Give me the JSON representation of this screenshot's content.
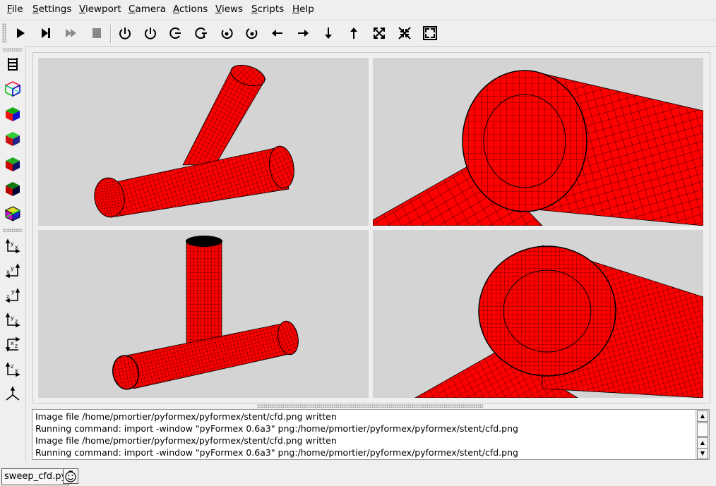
{
  "menubar": {
    "items": [
      {
        "accel": "F",
        "rest": "ile"
      },
      {
        "accel": "S",
        "rest": "ettings"
      },
      {
        "accel": "V",
        "rest": "iewport"
      },
      {
        "accel": "C",
        "rest": "amera"
      },
      {
        "accel": "A",
        "rest": "ctions"
      },
      {
        "accel": "V",
        "rest": "iews"
      },
      {
        "accel": "S",
        "rest": "cripts"
      },
      {
        "accel": "H",
        "rest": "elp"
      }
    ]
  },
  "toolbar": {
    "icons": [
      "play-icon",
      "step-icon",
      "continue-icon",
      "stop-icon",
      "rotate-left-icon",
      "rotate-right-icon",
      "rotate-up-icon",
      "rotate-down-icon",
      "rotate-cw-icon",
      "rotate-ccw-icon",
      "pan-left-icon",
      "pan-right-icon",
      "pan-down-icon",
      "pan-up-icon",
      "zoom-in-icon",
      "zoom-out-icon",
      "zoom-all-icon"
    ]
  },
  "side_toolbar": {
    "render_icons": [
      "wireframe-icon",
      "smooth-icon",
      "smoothwire-icon",
      "flat-icon",
      "flatwire-icon",
      "smooth-transparent-icon",
      "transparent-icon"
    ],
    "view_icons": [
      {
        "name": "front-view-icon",
        "a": "y",
        "b": "x"
      },
      {
        "name": "back-view-icon",
        "a": "y",
        "b": "x"
      },
      {
        "name": "right-view-icon",
        "a": "y",
        "b": "z"
      },
      {
        "name": "left-view-icon",
        "a": "y",
        "b": "z"
      },
      {
        "name": "top-view-icon",
        "a": "x",
        "b": "z"
      },
      {
        "name": "bottom-view-icon",
        "a": "z",
        "b": "x"
      },
      {
        "name": "iso-view-icon",
        "a": "",
        "b": ""
      }
    ]
  },
  "colors": {
    "mesh_fill": "#ff0000",
    "mesh_line": "#000000",
    "viewport_bg": "#d4d4d4"
  },
  "console": {
    "lines": [
      "Image file /home/pmortier/pyformex/pyformex/stent/cfd.png written",
      "Running command: import -window \"pyFormex 0.6a3\" png:/home/pmortier/pyformex/pyformex/stent/cfd.png",
      "Image file /home/pmortier/pyformex/pyformex/stent/cfd.png written",
      "Running command: import -window \"pyFormex 0.6a3\" png:/home/pmortier/pyformex/pyformex/stent/cfd.png"
    ]
  },
  "statusbar": {
    "script_name": "sweep_cfd.py"
  }
}
